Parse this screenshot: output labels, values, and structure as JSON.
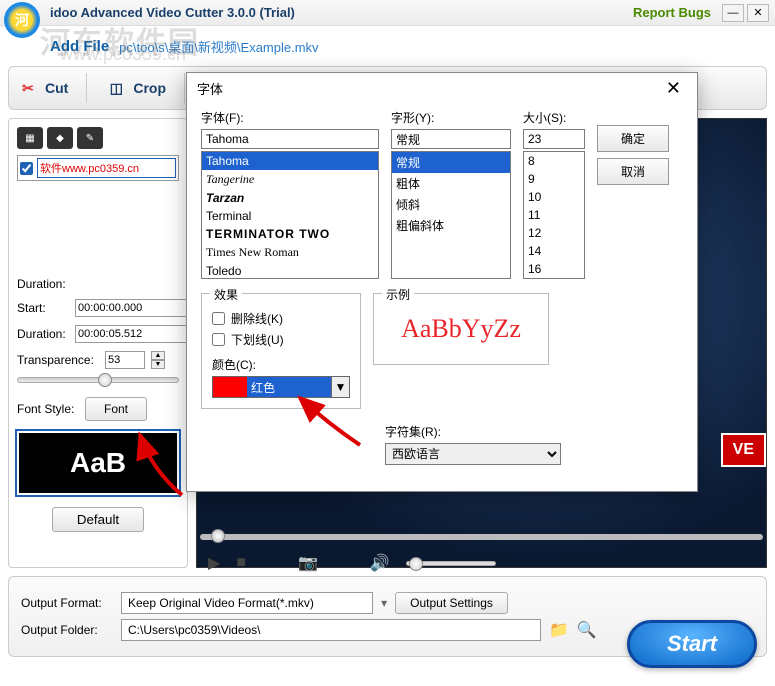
{
  "titlebar": {
    "title": "idoo Advanced Video Cutter 3.0.0 (Trial)",
    "report_bugs": "Report Bugs"
  },
  "watermark": {
    "line1": "河东软件园",
    "line2": "www.pc0359.cn"
  },
  "addfile": {
    "label": "Add File",
    "path": "pc\\too\\s\\桌面\\新视频\\Example.mkv"
  },
  "toolbar": {
    "cut": "Cut",
    "crop": "Crop"
  },
  "left": {
    "checkbox_text": "软件www.pc0359.cn",
    "duration_header": "Duration:",
    "start_label": "Start:",
    "start_value": "00:00:00.000",
    "duration_label": "Duration:",
    "duration_value": "00:00:05.512",
    "transparence_label": "Transparence:",
    "transparence_value": "53",
    "fontstyle_label": "Font Style:",
    "font_btn": "Font",
    "preview": "AaB",
    "default_btn": "Default"
  },
  "video": {
    "badge": "VE"
  },
  "bottom": {
    "output_format_label": "Output Format:",
    "output_format_value": "Keep Original Video Format(*.mkv)",
    "output_settings": "Output Settings",
    "output_folder_label": "Output Folder:",
    "output_folder_value": "C:\\Users\\pc0359\\Videos\\",
    "start": "Start"
  },
  "dialog": {
    "title": "字体",
    "font_label": "字体(F):",
    "font_value": "Tahoma",
    "font_items": [
      "Tahoma",
      "Tangerine",
      "Tarzan",
      "Terminal",
      "TERMINATOR TWO",
      "Times New Roman",
      "Toledo"
    ],
    "style_label": "字形(Y):",
    "style_value": "常规",
    "style_items": [
      "常规",
      "粗体",
      "倾斜",
      "粗偏斜体"
    ],
    "size_label": "大小(S):",
    "size_value": "23",
    "size_items": [
      "8",
      "9",
      "10",
      "11",
      "12",
      "14",
      "16"
    ],
    "ok": "确定",
    "cancel": "取消",
    "effect_legend": "效果",
    "strike": "删除线(K)",
    "underline": "下划线(U)",
    "color_label": "颜色(C):",
    "color_value": "红色",
    "sample_legend": "示例",
    "sample_text": "AaBbYyZz",
    "charset_label": "字符集(R):",
    "charset_value": "西欧语言"
  }
}
